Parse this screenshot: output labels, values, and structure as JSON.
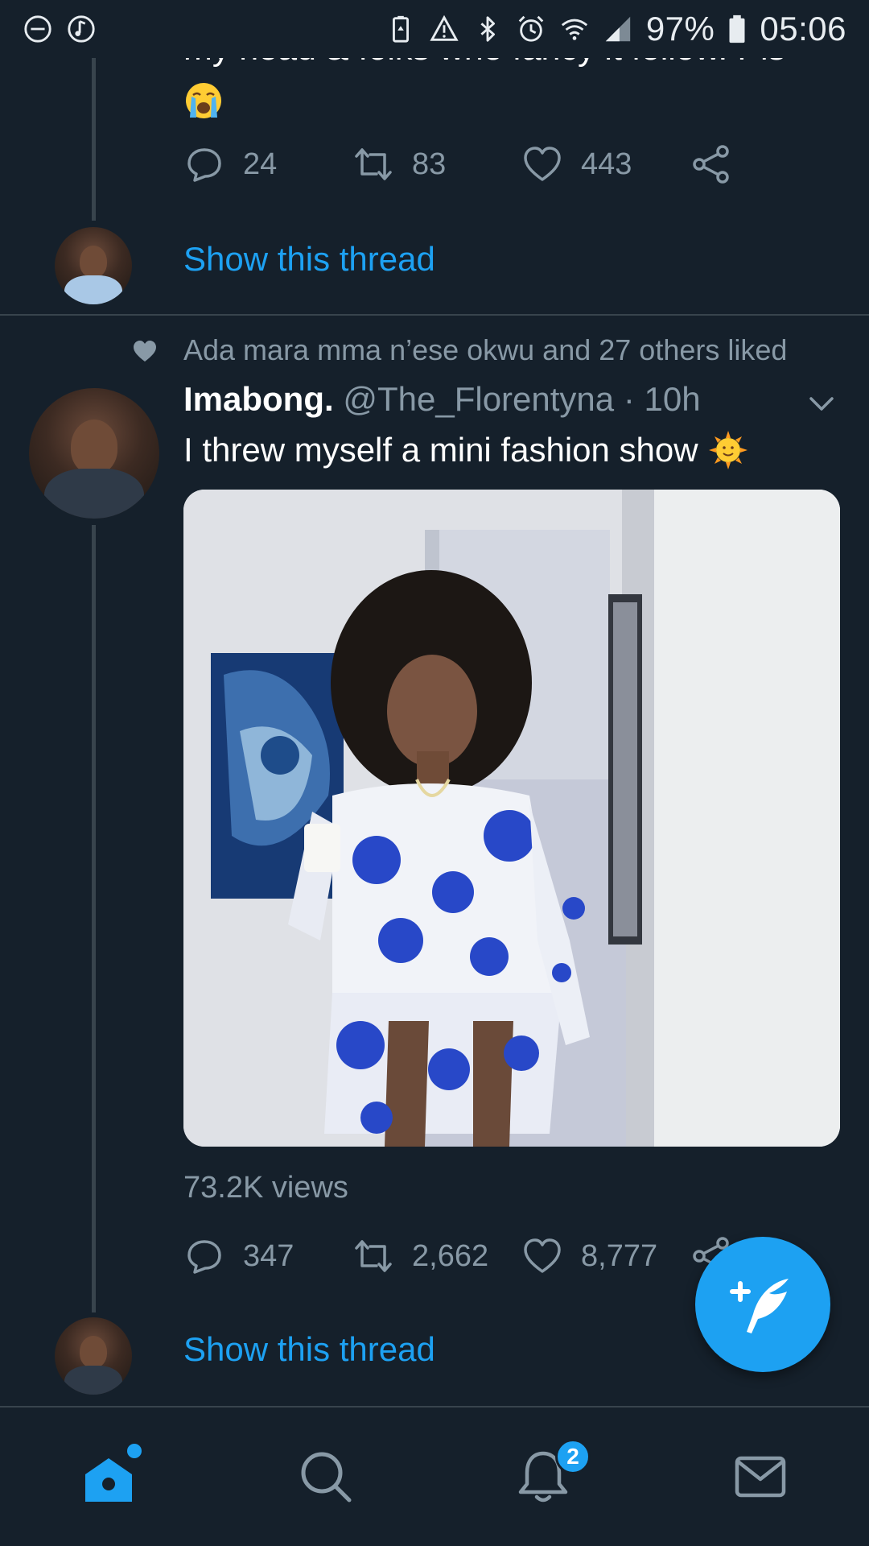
{
  "status_bar": {
    "battery_percent": "97%",
    "time": "05:06",
    "left_icons": [
      "do-not-disturb-icon",
      "music-note-icon"
    ],
    "right_icons": [
      "battery-saver-icon",
      "warning-icon",
      "bluetooth-icon",
      "alarm-icon",
      "wifi-icon",
      "signal-icon",
      "battery-icon"
    ]
  },
  "previous_tweet": {
    "cut_off_text": "my head & folks who fancy it follow. Pls",
    "emoji": "loudly-crying-face",
    "actions": {
      "replies": "24",
      "retweets": "83",
      "likes": "443"
    },
    "show_thread_label": "Show this thread"
  },
  "tweet": {
    "social_context": "Ada mara mma n’ese okwu and 27 others liked",
    "display_name": "Imabong.",
    "handle": "@The_Florentyna",
    "separator": "·",
    "time_ago": "10h",
    "text": "I threw myself a mini fashion show",
    "text_emoji": "sun-with-face",
    "views": "73.2K views",
    "actions": {
      "replies": "347",
      "retweets": "2,662",
      "likes": "8,777"
    },
    "show_thread_label": "Show this thread"
  },
  "fab": {
    "icon": "compose-tweet-icon"
  },
  "bottom_nav": {
    "items": [
      "home-icon",
      "search-icon",
      "notifications-icon",
      "messages-icon"
    ],
    "notifications_badge": "2"
  },
  "colors": {
    "background": "#15202b",
    "accent": "#1da1f2",
    "muted_text": "#8899a6",
    "divider": "#38444d"
  }
}
